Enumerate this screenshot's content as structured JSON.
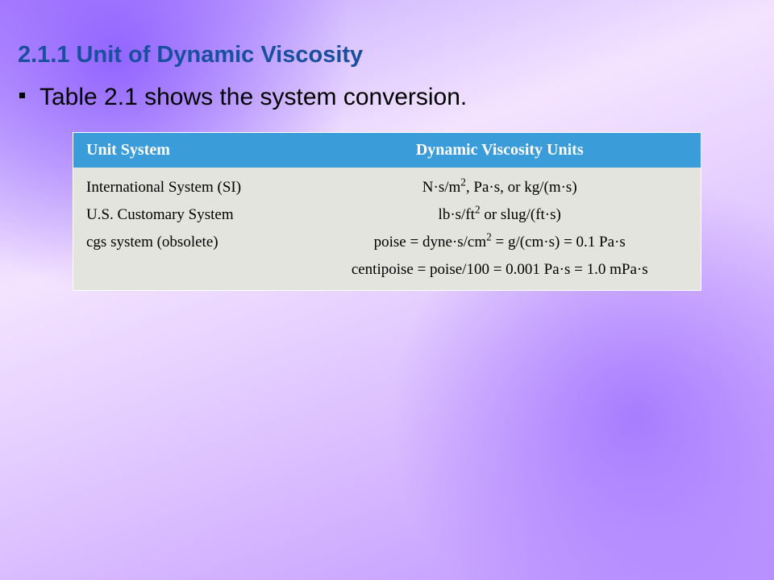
{
  "title": "2.1.1 Unit of Dynamic Viscosity",
  "bullet": "Table 2.1 shows the system conversion.",
  "table": {
    "head": {
      "c1": "Unit System",
      "c2": "Dynamic Viscosity Units"
    },
    "rows": [
      {
        "c1": "International System (SI)",
        "c2_html": "N·s/m<sup>2</sup>, Pa·s, or kg/(m·s)"
      },
      {
        "c1": "U.S. Customary System",
        "c2_html": "lb·s/ft<sup>2</sup> or slug/(ft·s)"
      },
      {
        "c1": "cgs system (obsolete)",
        "c2_html": "poise = dyne·s/cm<sup>2</sup> = g/(cm·s) = 0.1 Pa·s"
      },
      {
        "c1": "",
        "c2_html": "centipoise = poise/100 = 0.001 Pa·s = 1.0 mPa·s"
      }
    ]
  }
}
